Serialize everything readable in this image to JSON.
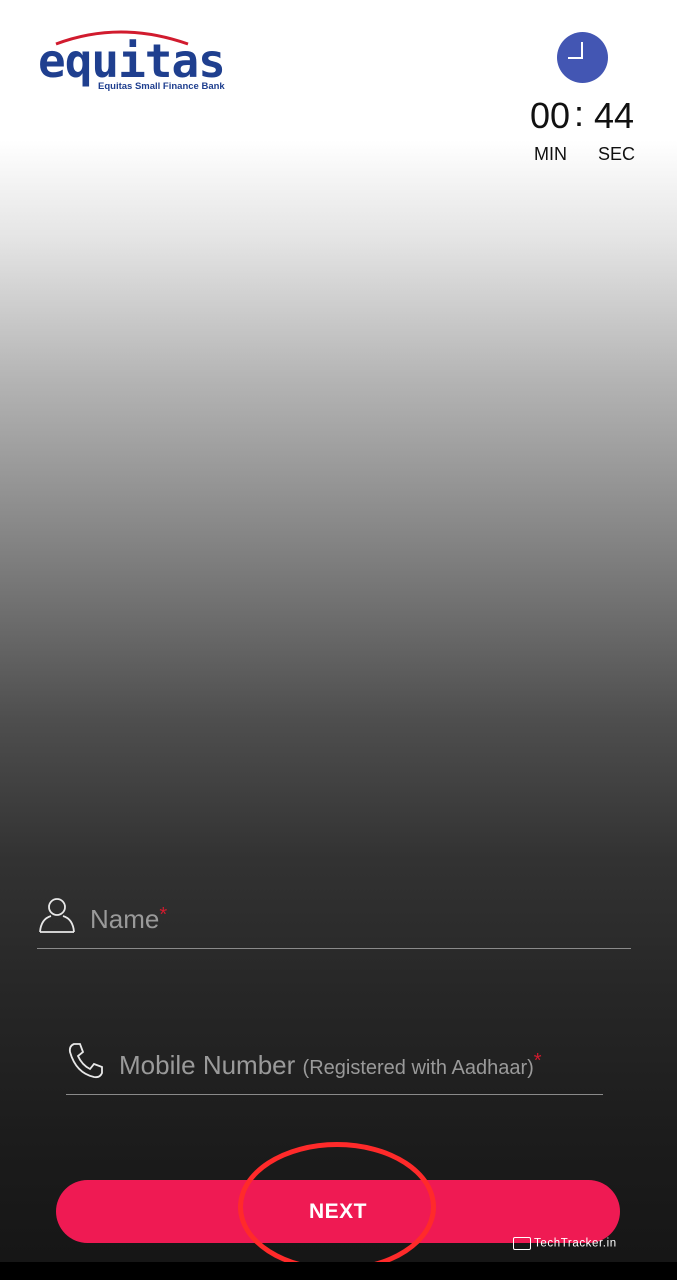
{
  "logo": {
    "word": "equitas",
    "tagline": "Equitas Small Finance Bank"
  },
  "timer": {
    "icon": "clock-icon",
    "minutes": "00",
    "separator": ":",
    "seconds": "44",
    "min_label": "MIN",
    "sec_label": "SEC"
  },
  "form": {
    "name": {
      "icon": "person-icon",
      "placeholder": "Name",
      "required_mark": "*"
    },
    "mobile": {
      "icon": "phone-icon",
      "placeholder": "Mobile Number",
      "hint": "(Registered with Aadhaar)",
      "required_mark": "*"
    },
    "next_label": "NEXT"
  },
  "watermark": {
    "icon": "browser-icon",
    "text": "TechTracker.in"
  },
  "colors": {
    "brand_blue": "#1f3f8f",
    "brand_red": "#d11b2e",
    "button": "#ef1a53",
    "clock": "#4356b3",
    "highlight": "#ff2a2a"
  }
}
